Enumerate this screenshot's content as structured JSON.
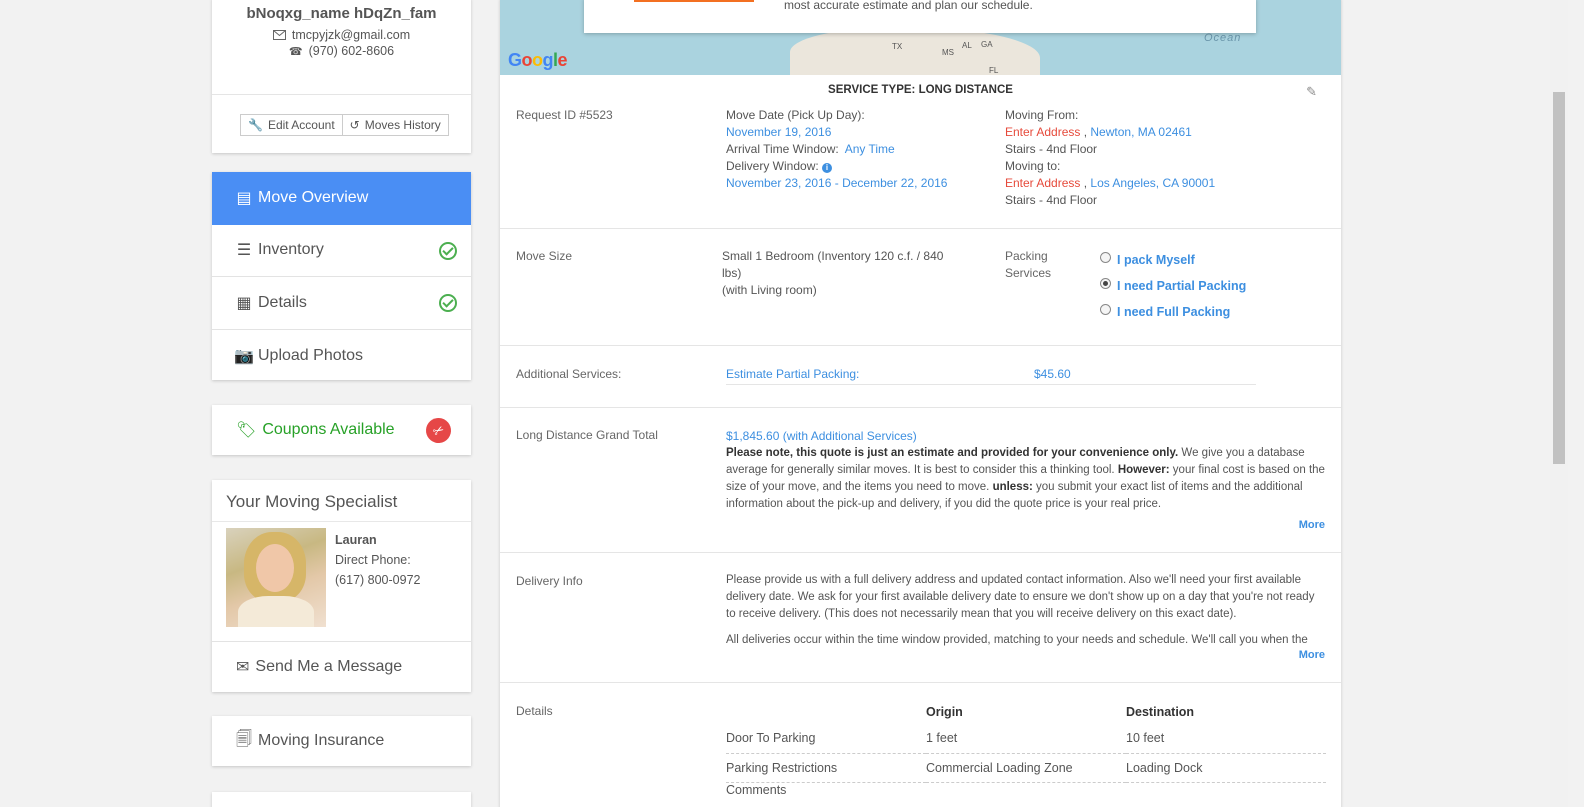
{
  "profile": {
    "name": "bNoqxg_name hDqZn_fam",
    "email": "tmcpyjzk@gmail.com",
    "phone": "(970) 602-8606",
    "edit_account": "Edit Account",
    "moves_history": "Moves History"
  },
  "nav": {
    "items": [
      {
        "label": "Move Overview",
        "icon": "list-alt-icon",
        "active": true
      },
      {
        "label": "Inventory",
        "icon": "list-icon",
        "complete": true
      },
      {
        "label": "Details",
        "icon": "id-card-icon",
        "complete": true
      },
      {
        "label": "Upload Photos",
        "icon": "camera-icon"
      }
    ]
  },
  "coupons": {
    "label": "Coupons Available",
    "icon": "tag-icon"
  },
  "specialist": {
    "heading": "Your Moving Specialist",
    "name": "Lauran",
    "phone_label": "Direct Phone:",
    "phone": "(617) 800-0972",
    "message_button": "Send Me a Message"
  },
  "insurance": {
    "label": "Moving Insurance",
    "icon": "document-icon"
  },
  "map": {
    "banner_text": "most accurate estimate and plan our schedule.",
    "ocean_label": "Ocean",
    "google_logo": "Google",
    "state_tags": [
      "TX",
      "AL",
      "MS",
      "GA",
      "FL"
    ]
  },
  "service": {
    "title": "SERVICE TYPE: LONG DISTANCE",
    "request_id": "Request ID #5523",
    "move_date_label": "Move Date (Pick Up Day):",
    "move_date": "November 19, 2016",
    "arrival_label": "Arrival Time Window:",
    "arrival": "Any Time",
    "delivery_window_label": "Delivery Window:",
    "delivery_window": "November 23, 2016 - December 22, 2016",
    "moving_from_label": "Moving From:",
    "from_enter": "Enter Address",
    "from_city": "Newton, MA 02461",
    "from_floor": "Stairs - 4nd Floor",
    "moving_to_label": "Moving to:",
    "to_enter": "Enter Address",
    "to_city": "Los Angeles, CA 90001",
    "to_floor": "Stairs - 4nd Floor"
  },
  "move_size": {
    "label": "Move Size",
    "value_line1": "Small 1 Bedroom (Inventory 120 c.f. / 840",
    "value_line2": "lbs)",
    "value_line3": "(with Living room)",
    "packing_label_1": "Packing",
    "packing_label_2": "Services",
    "options": [
      {
        "label": "I pack Myself",
        "selected": false
      },
      {
        "label": "I need Partial Packing",
        "selected": true
      },
      {
        "label": "I need Full Packing",
        "selected": false
      }
    ]
  },
  "additional": {
    "label": "Additional Services:",
    "item": "Estimate Partial Packing:",
    "price": "$45.60"
  },
  "grand_total": {
    "label": "Long Distance Grand Total",
    "value": "$1,845.60 (with Additional Services)",
    "note_bold": "Please note, this quote is just an estimate and provided for your convenience only.",
    "note_1": " We give you a database average for generally similar moves. It is best to consider this a thinking tool. ",
    "note_bold2": "However:",
    "note_2": " your final cost is based on the size of your move, and the items you need to move. ",
    "note_bold3": "unless:",
    "note_3": " you submit your exact list of items and the additional information about the pick-up and delivery, if you did the quote price is your real price.",
    "more": "More"
  },
  "delivery_info": {
    "label": "Delivery Info",
    "para1": "Please provide us with a full delivery address and updated contact information. Also we'll need your first available delivery date. We ask for your first available delivery date to ensure we don't show up on a day that you're not ready to receive delivery. (This does not necessarily mean that you will receive delivery on this exact date).",
    "para2": "All deliveries occur within the time window provided, matching to your needs and schedule. We'll call you when the",
    "more": "More"
  },
  "details": {
    "label": "Details",
    "col_origin": "Origin",
    "col_destination": "Destination",
    "rows": [
      {
        "name": "Door To Parking",
        "origin": "1 feet",
        "destination": "10 feet"
      },
      {
        "name": "Parking Restrictions",
        "origin": "Commercial Loading Zone",
        "destination": "Loading Dock"
      },
      {
        "name": "Comments",
        "origin": "",
        "destination": ""
      }
    ]
  }
}
